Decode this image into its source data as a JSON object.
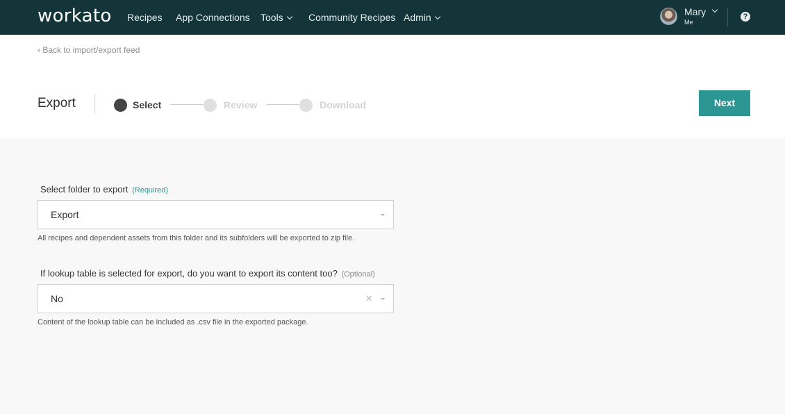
{
  "nav": {
    "logo": "workato",
    "items": [
      {
        "label": "Recipes"
      },
      {
        "label": "App Connections"
      },
      {
        "label": "Tools"
      },
      {
        "label": "Community Recipes"
      },
      {
        "label": "Admin"
      }
    ],
    "user": {
      "name": "Mary",
      "sub": "Me"
    },
    "help_icon": "?"
  },
  "header": {
    "back_link": "‹ Back to import/export feed",
    "title": "Export",
    "steps": [
      {
        "label": "Select",
        "active": true
      },
      {
        "label": "Review",
        "active": false
      },
      {
        "label": "Download",
        "active": false
      }
    ],
    "next_label": "Next"
  },
  "form": {
    "folder": {
      "label": "Select folder to export",
      "tag": "(Required)",
      "value": "Export",
      "hint": "All recipes and dependent assets from this folder and its subfolders will be exported to zip file."
    },
    "lookup": {
      "label": "If lookup table is selected for export, do you want to export its content too?",
      "tag": "(Optional)",
      "value": "No",
      "clear": "×",
      "hint": "Content of the lookup table can be included as .csv file in the exported package."
    }
  },
  "colors": {
    "nav_bg": "#13353a",
    "accent": "#2b9693",
    "page_bg": "#f8f8f8"
  }
}
